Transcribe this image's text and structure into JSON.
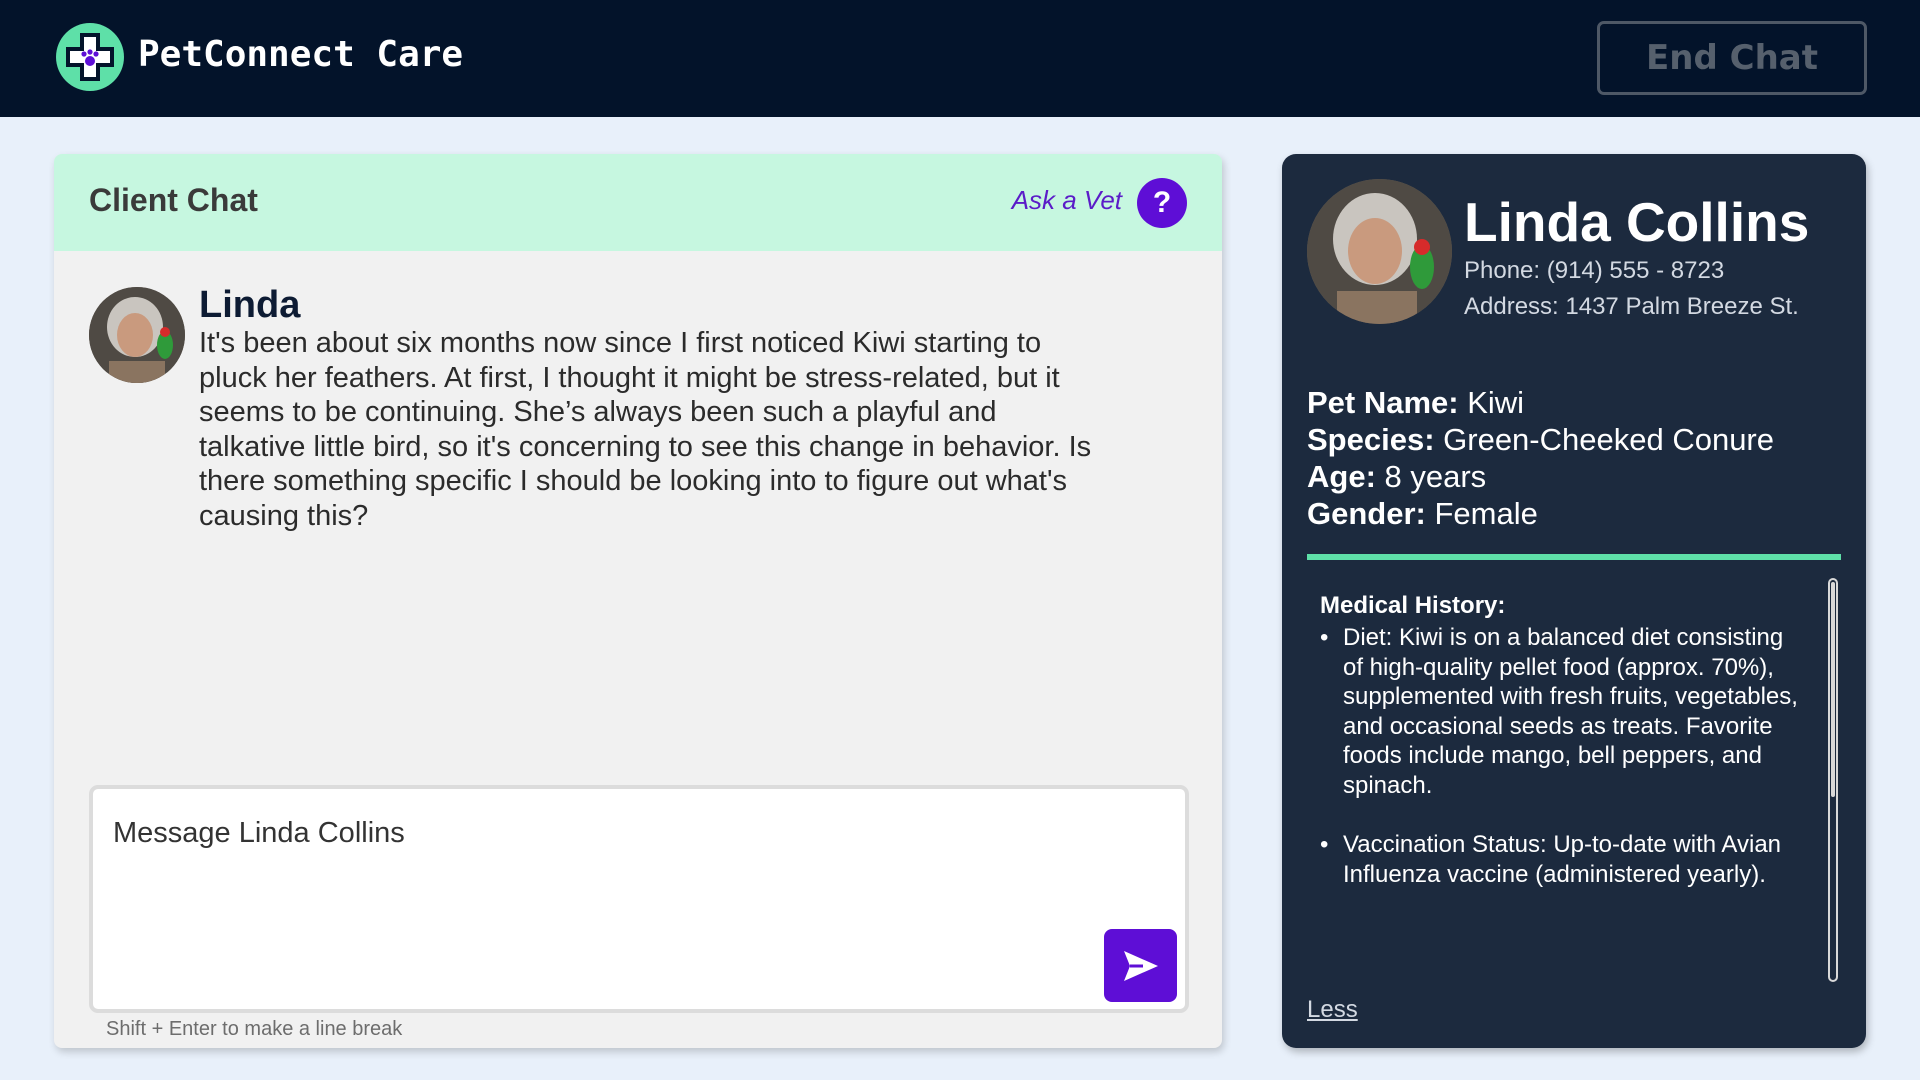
{
  "header": {
    "brand": "PetConnect Care",
    "logo_icon": "paw-cross-icon",
    "end_chat_label": "End Chat"
  },
  "chat": {
    "title": "Client Chat",
    "ask_vet_label": "Ask a Vet",
    "help_symbol": "?",
    "message": {
      "sender": "Linda",
      "text": "It's been about six months now since I first noticed Kiwi starting to pluck her feathers. At first, I thought it might be stress-related, but it seems to be continuing. She’s always been such a playful and talkative little bird, so it's concerning to see this change in behavior. Is there something specific I should be looking into to figure out what's causing this?"
    },
    "compose_placeholder": "Message Linda Collins",
    "compose_value": "",
    "hint": "Shift + Enter to make a line break"
  },
  "client": {
    "name": "Linda Collins",
    "phone": "Phone: (914) 555 - 8723",
    "address": "Address: 1437 Palm Breeze St.",
    "pet": {
      "name_label": "Pet Name:",
      "name": "Kiwi",
      "species_label": "Species:",
      "species": "Green-Cheeked Conure",
      "age_label": "Age:",
      "age": "8 years",
      "gender_label": "Gender:",
      "gender": "Female"
    },
    "medical_history": {
      "title": "Medical History:",
      "items": [
        "Diet: Kiwi is on a balanced diet consisting of high-quality pellet food (approx. 70%), supplemented with fresh fruits, vegetables, and occasional seeds as treats. Favorite foods include mango, bell peppers, and spinach.",
        "Vaccination Status: Up-to-date with Avian Influenza vaccine (administered yearly)."
      ]
    },
    "less_label": "Less"
  },
  "colors": {
    "topbar": "#03132a",
    "accent_purple": "#5e0ed6",
    "accent_green": "#5ee0a8",
    "chat_header": "#c6f7e0",
    "client_panel": "#1c2a3e"
  }
}
